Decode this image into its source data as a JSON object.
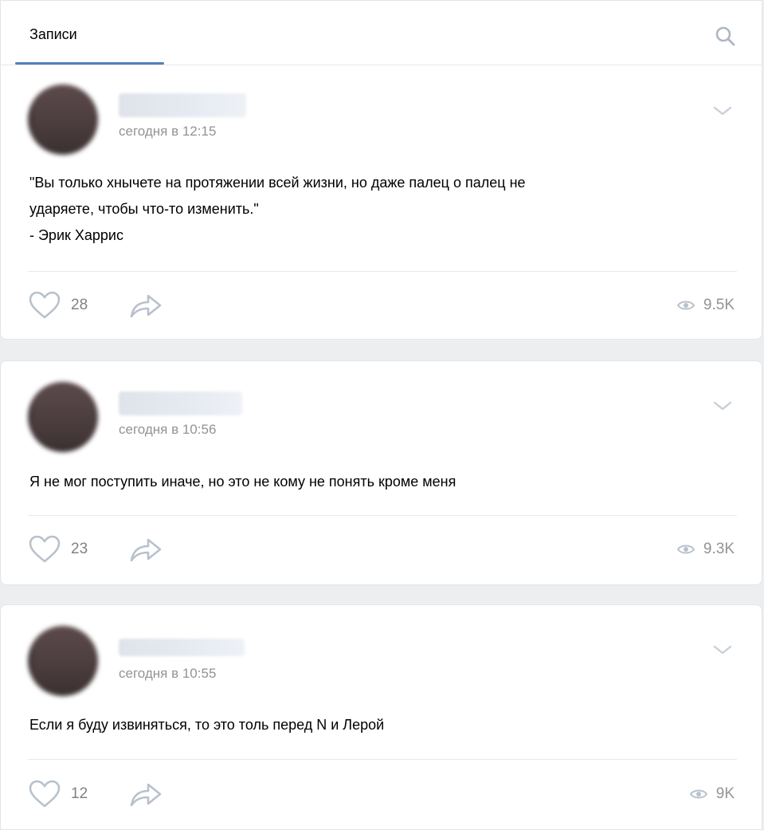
{
  "tabs": {
    "active_label": "Записи"
  },
  "posts": [
    {
      "time": "сегодня в 12:15",
      "text": "\"Вы только хнычете на протяжении всей жизни, но даже палец о палец не\nударяете, чтобы что-то изменить.\"\n- Эрик Харрис",
      "likes": "28",
      "views": "9.5K"
    },
    {
      "time": "сегодня в 10:56",
      "text": "Я не мог поступить иначе, но это не кому не понять кроме меня",
      "likes": "23",
      "views": "9.3K"
    },
    {
      "time": "сегодня в 10:55",
      "text": "Если я буду извиняться, то это толь перед N и Лерой",
      "likes": "12",
      "views": "9K"
    }
  ],
  "icons": {
    "search": "search-icon",
    "chevron": "chevron-down-icon",
    "like": "heart-icon",
    "share": "share-arrow-icon",
    "views": "eye-icon"
  },
  "colors": {
    "accent": "#5181b8",
    "muted_text": "#939393",
    "background": "#edeef0"
  }
}
